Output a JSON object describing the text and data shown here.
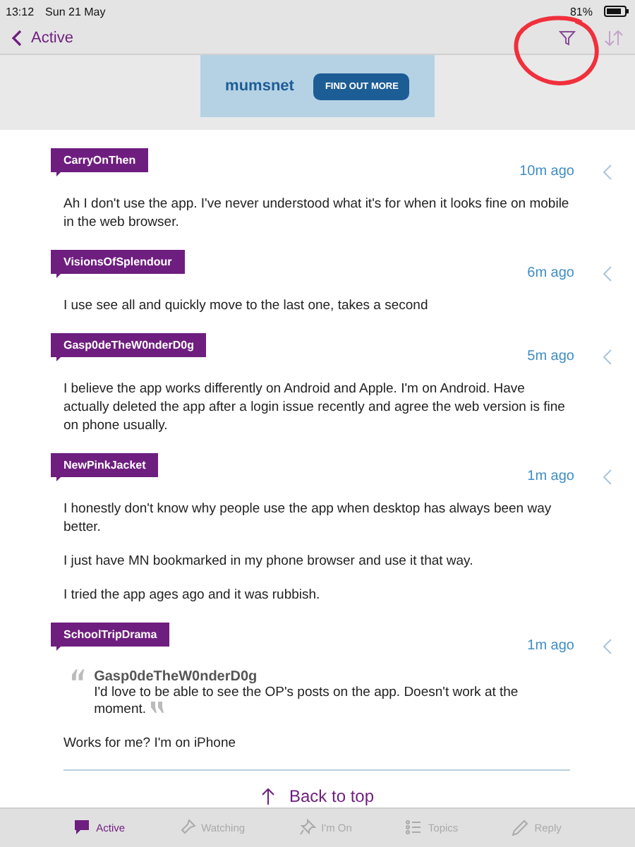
{
  "status_bar": {
    "time": "13:12",
    "date": "Sun 21 May",
    "battery": "81%"
  },
  "nav": {
    "back_label": "Active"
  },
  "ad": {
    "logo": "mumsnet",
    "button": "FIND OUT MORE"
  },
  "posts": [
    {
      "author": "CarryOnThen",
      "time": "10m ago",
      "paragraphs": [
        "Ah I don't use the app. I've never understood what it's for when it looks fine on mobile in the web browser."
      ]
    },
    {
      "author": "VisionsOfSplendour",
      "time": "6m ago",
      "paragraphs": [
        "I use see all and quickly move to the last one, takes a second"
      ]
    },
    {
      "author": "Gasp0deTheW0nderD0g",
      "time": "5m ago",
      "paragraphs": [
        "I believe the app works differently on Android and Apple. I'm on Android. Have actually deleted the app after a login issue recently and agree the web version is fine on phone usually."
      ]
    },
    {
      "author": "NewPinkJacket",
      "time": "1m ago",
      "paragraphs": [
        "I honestly don't know why people use the app when desktop has always been way better.",
        "I just have MN bookmarked in my phone browser and use it that way.",
        "I tried the app ages ago and it was rubbish."
      ]
    },
    {
      "author": "SchoolTripDrama",
      "time": "1m ago",
      "quote": {
        "author": "Gasp0deTheW0nderD0g",
        "text": "I'd love to be able to see the OP's posts on the app. Doesn't work at the moment."
      },
      "paragraphs": [
        "Works for me? I'm on iPhone"
      ]
    }
  ],
  "back_to_top": "Back to top",
  "tabs": [
    {
      "kind": "active",
      "label": "Active",
      "selected": true
    },
    {
      "kind": "watching",
      "label": "Watching",
      "selected": false
    },
    {
      "kind": "pin",
      "label": "I'm On",
      "selected": false
    },
    {
      "kind": "topics",
      "label": "Topics",
      "selected": false
    },
    {
      "kind": "reply",
      "label": "Reply",
      "selected": false
    }
  ]
}
